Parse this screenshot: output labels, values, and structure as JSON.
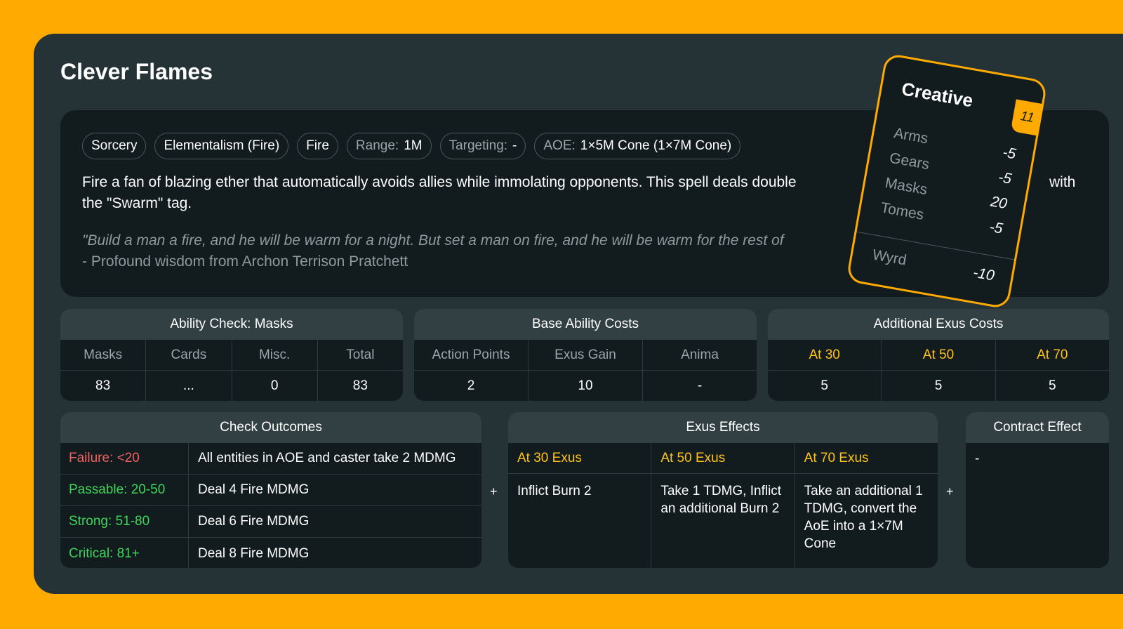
{
  "title": "Clever Flames",
  "tags": [
    {
      "value": "Sorcery"
    },
    {
      "value": "Elementalism (Fire)"
    },
    {
      "value": "Fire"
    },
    {
      "key": "Range:",
      "value": "1M"
    },
    {
      "key": "Targeting:",
      "value": "-"
    },
    {
      "key": "AOE:",
      "value": "1×5M Cone (1×7M Cone)"
    }
  ],
  "description": "Fire a fan of blazing ether that automatically avoids allies while immolating opponents. This spell deals double",
  "description_tail": "with",
  "description_line2": "the \"Swarm\" tag.",
  "quote": "\"Build a man a fire, and he will be warm for a night. But set a man on fire, and he will be warm for the rest of",
  "attribution": "- Profound wisdom from Archon Terrison Pratchett",
  "ability_check": {
    "title": "Ability Check: Masks",
    "headers": [
      "Masks",
      "Cards",
      "Misc.",
      "Total"
    ],
    "values": [
      "83",
      "...",
      "0",
      "83"
    ]
  },
  "base_costs": {
    "title": "Base Ability Costs",
    "headers": [
      "Action Points",
      "Exus Gain",
      "Anima"
    ],
    "values": [
      "2",
      "10",
      "-"
    ]
  },
  "exus_costs": {
    "title": "Additional Exus Costs",
    "headers": [
      "At 30",
      "At 50",
      "At 70"
    ],
    "values": [
      "5",
      "5",
      "5"
    ]
  },
  "check_outcomes": {
    "title": "Check Outcomes",
    "rows": [
      {
        "label": "Failure: <20",
        "value": "All entities in AOE and caster take 2 MDMG",
        "color": "#F0615F"
      },
      {
        "label": "Passable: 20-50",
        "value": "Deal 4 Fire MDMG",
        "color": "#3FD45A"
      },
      {
        "label": "Strong: 51-80",
        "value": "Deal 6 Fire MDMG",
        "color": "#3FD45A"
      },
      {
        "label": "Critical: 81+",
        "value": "Deal 8 Fire MDMG",
        "color": "#3FD45A"
      }
    ]
  },
  "plus": "+",
  "exus_effects": {
    "title": "Exus Effects",
    "columns": [
      {
        "header": "At 30 Exus",
        "text": "Inflict Burn 2"
      },
      {
        "header": "At 50 Exus",
        "text": "Take 1 TDMG, Inflict an additional Burn 2"
      },
      {
        "header": "At 70 Exus",
        "text": "Take an additional 1 TDMG, convert the AoE into a 1×7M Cone"
      }
    ]
  },
  "contract_effect": {
    "title": "Contract Effect",
    "text": "-"
  },
  "card": {
    "title": "Creative",
    "badge": "11",
    "rows": [
      {
        "label": "Arms",
        "value": "-5"
      },
      {
        "label": "Gears",
        "value": "-5"
      },
      {
        "label": "Masks",
        "value": "20"
      },
      {
        "label": "Tomes",
        "value": "-5"
      }
    ],
    "footer": {
      "label": "Wyrd",
      "value": "-10"
    }
  },
  "colors": {
    "background": "#FFAA00",
    "panel": "#253236",
    "table_dark": "#121C1F",
    "table_head": "#323F43",
    "accent_yellow": "#FFC21A",
    "failure_red": "#F0615F",
    "success_green": "#3FD45A"
  }
}
